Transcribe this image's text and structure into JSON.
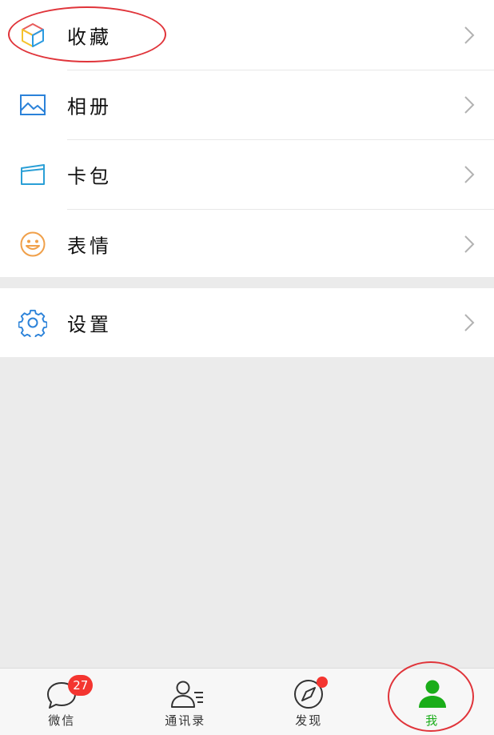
{
  "menu_group_1": [
    {
      "label": "收藏",
      "icon": "favorites-cube-icon"
    },
    {
      "label": "相册",
      "icon": "album-picture-icon"
    },
    {
      "label": "卡包",
      "icon": "card-wallet-icon"
    },
    {
      "label": "表情",
      "icon": "sticker-smiley-icon"
    }
  ],
  "menu_group_2": [
    {
      "label": "设置",
      "icon": "settings-gear-icon"
    }
  ],
  "tabbar": {
    "tabs": [
      {
        "label": "微信",
        "icon": "chat-bubble-icon",
        "badge": "27"
      },
      {
        "label": "通讯录",
        "icon": "contacts-icon"
      },
      {
        "label": "发现",
        "icon": "discover-compass-icon"
      },
      {
        "label": "我",
        "icon": "me-person-icon"
      }
    ],
    "active_tab": "我"
  },
  "colors": {
    "accent_green": "#1aad19",
    "badge_red": "#f43530",
    "annotation_red": "#e0343a",
    "blue_icon": "#2b82d9",
    "orange_icon": "#f0a04a"
  }
}
